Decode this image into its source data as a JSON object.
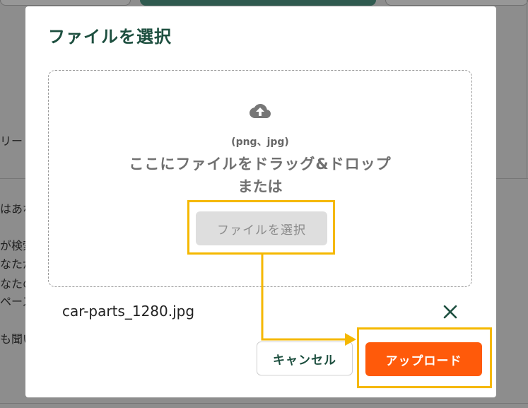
{
  "background": {
    "fragments": [
      "リー",
      "はあな",
      "が検索",
      "なたが",
      "なたの",
      "ペース",
      "も聞い"
    ]
  },
  "modal": {
    "title": "ファイルを選択",
    "dropzone": {
      "icon": "cloud-upload-icon",
      "accepted_types": "(png、jpg)",
      "instruction": "ここにファイルをドラッグ&ドロップ",
      "or_label": "または",
      "select_button_label": "ファイルを選択"
    },
    "selected_file": {
      "name": "car-parts_1280.jpg",
      "remove_icon": "close-icon"
    },
    "footer": {
      "cancel_label": "キャンセル",
      "upload_label": "アップロード"
    }
  },
  "colors": {
    "title": "#1d4f3f",
    "upload_button": "#ff5a0a",
    "annotation": "#f5b800",
    "select_button_bg": "#dedede"
  }
}
